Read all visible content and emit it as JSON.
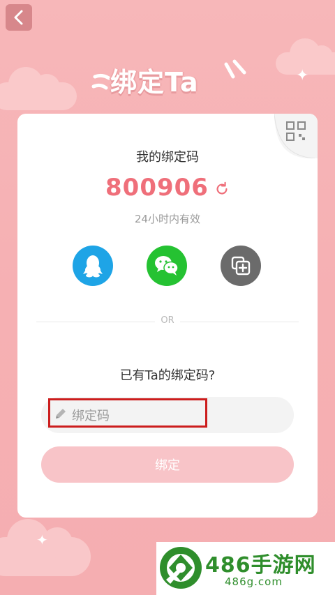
{
  "header": {
    "title": "绑定Ta",
    "back_icon": "chevron-left-icon"
  },
  "card": {
    "my_code_label": "我的绑定码",
    "code_value": "800906",
    "refresh_icon": "refresh-icon",
    "validity_text": "24小时内有效",
    "qr_icon": "qr-code-icon",
    "share_buttons": [
      {
        "icon": "qq-icon",
        "color": "#1ea4e6"
      },
      {
        "icon": "wechat-icon",
        "color": "#25c232"
      },
      {
        "icon": "copy-icon",
        "color": "#6b6b6b"
      }
    ],
    "divider_text": "OR",
    "have_code_label": "已有Ta的绑定码?",
    "input": {
      "placeholder": "绑定码",
      "value": "",
      "icon": "pencil-icon"
    },
    "bind_button_label": "绑定"
  },
  "watermark": {
    "title": "486手游网",
    "url": "486g.com"
  },
  "colors": {
    "background": "#f6b0b3",
    "code": "#ef6f7a",
    "bind_button": "#f8c4c8",
    "highlight": "#cc1d1d",
    "watermark": "#2f8e2c"
  }
}
